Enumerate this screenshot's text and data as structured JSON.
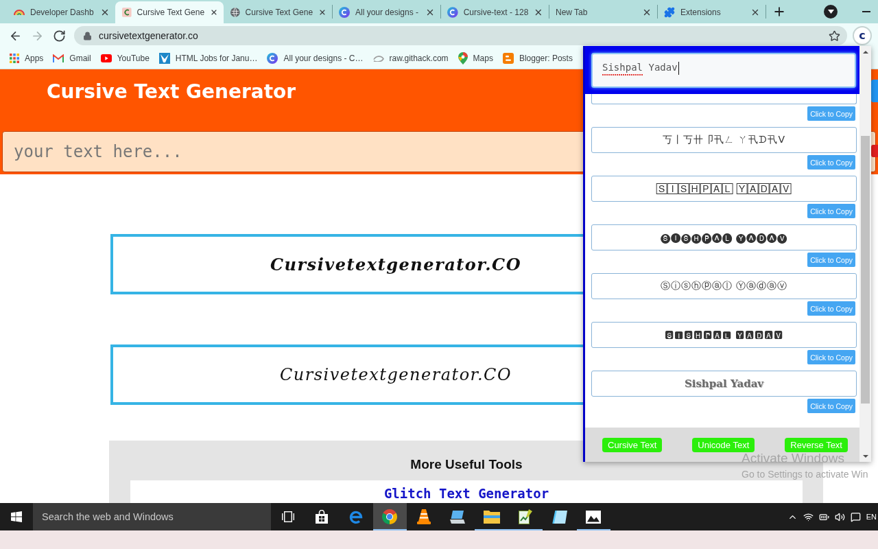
{
  "tabs": [
    {
      "title": "Developer Dashb",
      "kind": "rainbow",
      "selected": false
    },
    {
      "title": "Cursive Text Gene",
      "kind": "letter",
      "selected": true
    },
    {
      "title": "Cursive Text Gene",
      "kind": "globe",
      "selected": false
    },
    {
      "title": "All your designs -",
      "kind": "canva",
      "selected": false
    },
    {
      "title": "Cursive-text - 128",
      "kind": "canva",
      "selected": false
    },
    {
      "title": "New Tab",
      "kind": "none",
      "selected": false
    },
    {
      "title": "Extensions",
      "kind": "puzzle",
      "selected": false
    }
  ],
  "toolbar": {
    "nav_buttons": [
      {
        "kind": "back",
        "disabled": false
      },
      {
        "kind": "forward",
        "disabled": true
      },
      {
        "kind": "reload",
        "disabled": false
      }
    ],
    "url": "cursivetextgenerator.co",
    "secure": true,
    "bookmarked": false,
    "extension_button": {
      "label": "c",
      "open": true
    }
  },
  "bookmarks": [
    {
      "label": "Apps",
      "kind": "apps"
    },
    {
      "label": "Gmail",
      "kind": "gmail"
    },
    {
      "label": "YouTube",
      "kind": "youtube"
    },
    {
      "label": "HTML Jobs for Janu…",
      "kind": "jobs"
    },
    {
      "label": "All your designs - C…",
      "kind": "canva"
    },
    {
      "label": "raw.githack.com",
      "kind": "githack"
    },
    {
      "label": "Maps",
      "kind": "maps"
    },
    {
      "label": "Blogger: Posts",
      "kind": "blogger"
    }
  ],
  "page": {
    "title": "Cursive Text Generator",
    "input": {
      "placeholder": "your text here..."
    },
    "previews": [
      {
        "text": "Cursivetextgenerator.CO",
        "kind": "bold"
      },
      {
        "text": "Cursivetextgenerator.CO",
        "kind": "light"
      }
    ],
    "tools": {
      "title": "More Useful Tools",
      "links": [
        "Glitch Text Generator"
      ]
    }
  },
  "popup": {
    "input": {
      "value_words": [
        {
          "text": "Sishpal",
          "misspelled": true
        },
        {
          "text": "Yadav",
          "misspelled": false
        }
      ],
      "focused": true
    },
    "results": [
      {
        "kind": "cut",
        "button": "Click to Copy"
      },
      {
        "kind": "symbols",
        "text": "丂丨丂卄卩卂ㄥ ㄚ卂ᗪ卂ᐯ",
        "button": "Click to Copy"
      },
      {
        "kind": "symbols",
        "text": "🅂🄸🅂🄷🄿🄰🄻 🅈🄰🄳🄰🅅",
        "button": "Click to Copy"
      },
      {
        "kind": "symbols",
        "text": "🅢🅘🅢🅗🅟🅐🅛 🅨🅐🅓🅐🅥",
        "button": "Click to Copy"
      },
      {
        "kind": "symbols",
        "text": "Ⓢⓘⓢⓗⓟⓐⓛ Ⓨⓐⓓⓐⓥ",
        "button": "Click to Copy"
      },
      {
        "kind": "symbols",
        "text": "🆂🅸🆂🅷🅿🅰🅻 🆈🅰🅳🅰🆅",
        "button": "Click to Copy"
      },
      {
        "kind": "serif",
        "text": "Sishpal Yadav",
        "button": "Click to Copy"
      }
    ],
    "footer_buttons": [
      "Cursive Text",
      "Unicode Text",
      "Reverse Text"
    ]
  },
  "taskbar": {
    "search": {
      "placeholder": "Search the web and Windows"
    },
    "apps": [
      {
        "kind": "task-view",
        "running": false,
        "selected": false
      },
      {
        "kind": "store",
        "running": false,
        "selected": false
      },
      {
        "kind": "edge",
        "running": false,
        "selected": false
      },
      {
        "kind": "chrome",
        "running": true,
        "selected": true
      },
      {
        "kind": "vlc",
        "running": false,
        "selected": false
      },
      {
        "kind": "pc",
        "running": false,
        "selected": false
      },
      {
        "kind": "folder",
        "running": true,
        "selected": false
      },
      {
        "kind": "notepad",
        "running": true,
        "selected": false
      },
      {
        "kind": "book",
        "running": false,
        "selected": false
      },
      {
        "kind": "photos",
        "running": true,
        "selected": false
      }
    ],
    "tray": [
      {
        "kind": "caret"
      },
      {
        "kind": "network"
      },
      {
        "kind": "battery"
      },
      {
        "kind": "volume"
      },
      {
        "kind": "notifications"
      }
    ],
    "language": "EN"
  },
  "activation_notice": {
    "title": "Activate Windows",
    "text": "Go to Settings to activate Win"
  }
}
